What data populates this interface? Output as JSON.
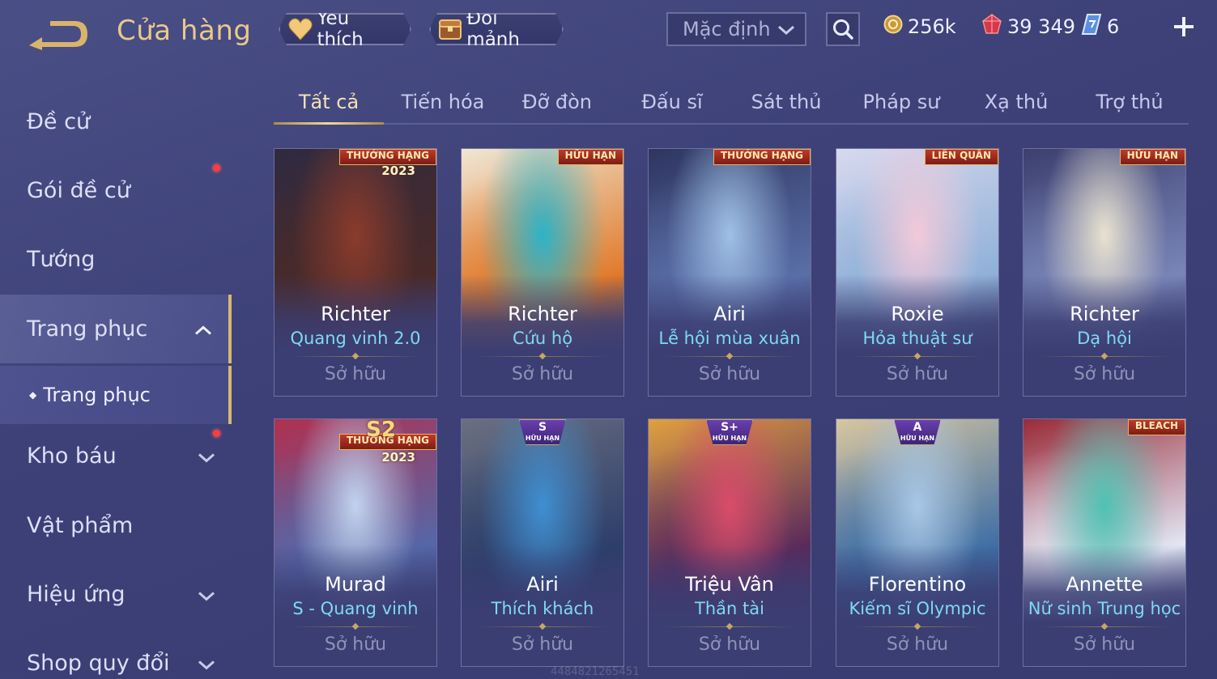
{
  "header": {
    "title": "Cửa hàng",
    "favorite_label": "Yêu thích",
    "exchange_label": "Đổi mảnh",
    "sort_selected": "Mặc định",
    "currencies": [
      {
        "name": "gold",
        "value": "256k",
        "icon": "gold-coin-icon"
      },
      {
        "name": "ruby",
        "value": "39 349",
        "icon": "ruby-icon"
      },
      {
        "name": "voucher",
        "value": "6",
        "icon": "voucher-icon"
      }
    ]
  },
  "sidebar": {
    "items": [
      {
        "label": "Đề cử"
      },
      {
        "label": "Gói đề cử"
      },
      {
        "label": "Tướng"
      },
      {
        "label": "Trang phục"
      },
      {
        "label": "Kho báu"
      },
      {
        "label": "Vật phẩm"
      },
      {
        "label": "Hiệu ứng"
      },
      {
        "label": "Shop quy đổi"
      }
    ],
    "sub_item": "Trang phục"
  },
  "tabs": [
    {
      "label": "Tất cả",
      "active": true
    },
    {
      "label": "Tiến hóa"
    },
    {
      "label": "Đỡ đòn"
    },
    {
      "label": "Đấu sĩ"
    },
    {
      "label": "Sát thủ"
    },
    {
      "label": "Pháp sư"
    },
    {
      "label": "Xạ thủ"
    },
    {
      "label": "Trợ thủ"
    }
  ],
  "cards": [
    {
      "hero": "Richter",
      "skin": "Quang vinh 2.0",
      "status": "Sở hữu",
      "badge": "THƯỞNG HẠNG",
      "badge_year": "2023",
      "palette": [
        "#8a3b2c",
        "#4a2a28",
        "#2f2a40"
      ]
    },
    {
      "hero": "Richter",
      "skin": "Cứu hộ",
      "status": "Sở hữu",
      "badge": "HỮU HẠN",
      "palette": [
        "#2db3c7",
        "#e07a2a",
        "#f0e6d4"
      ]
    },
    {
      "hero": "Airi",
      "skin": "Lễ hội mùa xuân",
      "status": "Sở hữu",
      "badge": "THƯỞNG HẠNG",
      "palette": [
        "#9fc0e6",
        "#5a6fa8",
        "#2e3560"
      ]
    },
    {
      "hero": "Roxie",
      "skin": "Hỏa thuật sư",
      "status": "Sở hữu",
      "badge": "LIÊN QUÂN",
      "palette": [
        "#f2c9d9",
        "#8fb0d8",
        "#d7d9ee"
      ]
    },
    {
      "hero": "Richter",
      "skin": "Dạ hội",
      "status": "Sở hữu",
      "badge": "HỮU HẠN",
      "palette": [
        "#e9e2d0",
        "#7a86b8",
        "#3c3f70"
      ]
    },
    {
      "hero": "Murad",
      "skin": "S - Quang vinh",
      "status": "Sở hữu",
      "badge": "THƯỞNG HẠNG",
      "badge_top": "S2",
      "badge_year": "2023",
      "palette": [
        "#c2d3ee",
        "#5567a8",
        "#b03050"
      ]
    },
    {
      "hero": "Airi",
      "skin": "Thích khách",
      "status": "Sở hữu",
      "tier": "S",
      "tier_sub": "HỮU HẠN",
      "palette": [
        "#3f8fd1",
        "#2c3e6a",
        "#6b6f80"
      ]
    },
    {
      "hero": "Triệu Vân",
      "skin": "Thần tài",
      "status": "Sở hữu",
      "tier": "S+",
      "tier_sub": "HỮU HẠN",
      "palette": [
        "#d94c6a",
        "#5a2a5c",
        "#e0a040"
      ]
    },
    {
      "hero": "Florentino",
      "skin": "Kiếm sĩ Olympic",
      "status": "Sở hữu",
      "tier": "A",
      "tier_sub": "HỮU HẠN",
      "palette": [
        "#a8c7e6",
        "#3f6fa5",
        "#d8c6a0"
      ]
    },
    {
      "hero": "Annette",
      "skin": "Nữ sinh Trung học",
      "status": "Sở hữu",
      "badge": "BLEACH",
      "palette": [
        "#4fc2b2",
        "#e3e7f5",
        "#9a2a38"
      ]
    }
  ],
  "watermark": "4484821265451",
  "colors": {
    "accent_gold": "#e9c98a",
    "skin_text": "#7fd9f2",
    "background": "#3d4178"
  }
}
